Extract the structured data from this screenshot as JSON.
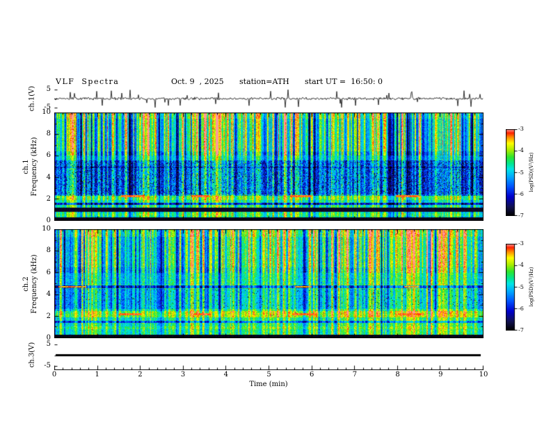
{
  "header": {
    "title": "VLF  Spectra",
    "date": "Oct. 9  , 2025",
    "station": "station=ATH",
    "start_ut": "start UT =  16:50: 0"
  },
  "xaxis": {
    "label": "Time (min)",
    "ticks": [
      "0",
      "1",
      "2",
      "3",
      "4",
      "5",
      "6",
      "7",
      "8",
      "9",
      "10"
    ],
    "range": [
      0,
      10
    ]
  },
  "panels": {
    "ch1_wave": {
      "ylabel": "ch.1(V)",
      "yticks": [
        "5",
        "-5"
      ],
      "yrange_shown": [
        5,
        -5
      ]
    },
    "ch1_spec": {
      "ylabel_line1": "ch.1",
      "ylabel_line2": "Frequency (kHz)",
      "yticks": [
        "10",
        "8",
        "6",
        "4",
        "2",
        "0"
      ]
    },
    "ch2_spec": {
      "ylabel_line1": "ch.2",
      "ylabel_line2": "Frequency (kHz)",
      "yticks": [
        "10",
        "8",
        "6",
        "4",
        "2",
        "0"
      ]
    },
    "ch3_wave": {
      "ylabel": "ch.3(V)",
      "yticks": [
        "5",
        "-5"
      ],
      "yrange_shown": [
        5,
        -5
      ]
    }
  },
  "colorbar": {
    "label": "log(PSD)(V²/Hz)",
    "ticks": [
      "-3",
      "-4",
      "-5",
      "-6",
      "-7"
    ],
    "range": [
      -7,
      -3
    ]
  },
  "colors": {
    "background": "#ffffff",
    "ink": "#000000",
    "colormap_stops": [
      [
        0.0,
        "#000000"
      ],
      [
        0.1,
        "#12124f"
      ],
      [
        0.22,
        "#0000cd"
      ],
      [
        0.34,
        "#0055ff"
      ],
      [
        0.45,
        "#00aaff"
      ],
      [
        0.54,
        "#00e6e6"
      ],
      [
        0.6,
        "#00e696"
      ],
      [
        0.68,
        "#2ee62e"
      ],
      [
        0.76,
        "#aaee00"
      ],
      [
        0.84,
        "#ffff00"
      ],
      [
        0.91,
        "#ff8c00"
      ],
      [
        0.96,
        "#ff2200"
      ],
      [
        1.0,
        "#ff9999"
      ]
    ]
  },
  "chart_data": [
    {
      "type": "line",
      "name": "ch1-voltage-waveform",
      "ylabel": "ch.1(V)",
      "ylim": [
        -7,
        7
      ],
      "yticks": [
        5,
        -5
      ],
      "xlim": [
        0,
        10
      ],
      "description": "Broadband noisy waveform centered on 0 V (~±1 V) with frequent impulsive spikes reaching ±5 V throughout the 10-minute record.",
      "gen": {
        "seed": 99,
        "noise_v": 0.55,
        "spike_prob": 0.055,
        "spike_vmin": 1.8,
        "spike_vmax": 5.0
      }
    },
    {
      "type": "heatmap",
      "name": "ch1-spectrogram",
      "xlabel": "Time (min)",
      "ylabel": "Frequency (kHz)",
      "xlim": [
        0,
        10
      ],
      "flim": [
        0,
        10
      ],
      "clim": [
        -7,
        -3
      ],
      "description": "VLF spectrogram: green/cyan sferic background with dense vertical impulsive stripes; suppressed blue speckled hiss band ~2.3-5.6 kHz; bright band near 2 kHz with intermittent dark-red narrowband bursts near 2.25 kHz; dark bands near 1 kHz and below 0.35 kHz; slightly enhanced power near 10 kHz.",
      "gen": {
        "seed": 20251009,
        "base": 0.6,
        "noise": 0.09,
        "stripe_gain": {
          "low": 0.45,
          "mid": 0.55,
          "high": 0.85
        },
        "col_bright_prob": 0.05,
        "col_dark_prob": 0.06,
        "bands": [
          {
            "f0": 2.3,
            "f1": 5.6,
            "delta": -0.21,
            "noise": 0.07,
            "dots": 0.05
          },
          {
            "f0": 5.6,
            "f1": 6.4,
            "delta": -0.08
          },
          {
            "f0": 9.4,
            "f1": 10.0,
            "delta": 0.07
          },
          {
            "f0": 1.9,
            "f1": 2.45,
            "delta": 0.1
          },
          {
            "f0": 4.85,
            "f1": 5.0,
            "delta": -0.12
          },
          {
            "f0": 1.45,
            "f1": 1.65,
            "delta": -0.35
          },
          {
            "f0": 0.85,
            "f1": 1.2,
            "set": 0.05
          },
          {
            "f0": 0.45,
            "f1": 0.7,
            "delta": 0.05
          },
          {
            "f0": 0.0,
            "f1": 0.35,
            "set": 0.03
          }
        ],
        "streaks": [
          {
            "f": 2.25,
            "halfwidth": 0.09,
            "value": 0.94,
            "segments": [
              [
                1.55,
                2.1
              ],
              [
                3.2,
                3.6
              ],
              [
                5.5,
                6.0
              ],
              [
                7.95,
                8.5
              ]
            ]
          }
        ]
      }
    },
    {
      "type": "heatmap",
      "name": "ch2-spectrogram",
      "xlabel": "Time (min)",
      "ylabel": "Frequency (kHz)",
      "xlim": [
        0,
        10
      ],
      "flim": [
        0,
        10
      ],
      "clim": [
        -7,
        -3
      ],
      "description": "VLF spectrogram: greener overall than ch.1; bright yellow-green band ~1.9-2.5 kHz with intermittent dark-red bursts near 2.2 kHz; dark narrow line near 4.7 kHz with red dashes; weak blue band 2.7-4.5 kHz; black band below 0.3 kHz; dense vertical sferic stripes across all frequencies.",
      "gen": {
        "seed": 424242,
        "base": 0.62,
        "noise": 0.1,
        "stripe_gain": {
          "low": 0.4,
          "mid": 0.5,
          "high": 0.75
        },
        "col_bright_prob": 0.06,
        "col_dark_prob": 0.05,
        "bands": [
          {
            "f0": 2.7,
            "f1": 4.5,
            "delta": -0.1,
            "dots": 0.02
          },
          {
            "f0": 5.0,
            "f1": 6.5,
            "delta": -0.05
          },
          {
            "f0": 9.3,
            "f1": 10.0,
            "delta": 0.08
          },
          {
            "f0": 1.9,
            "f1": 2.5,
            "delta": 0.14
          },
          {
            "f0": 4.6,
            "f1": 4.85,
            "delta": -0.3
          },
          {
            "f0": 1.4,
            "f1": 1.6,
            "delta": -0.25
          },
          {
            "f0": 0.8,
            "f1": 1.1,
            "delta": 0.06
          },
          {
            "f0": 0.0,
            "f1": 0.3,
            "set": 0.03
          }
        ],
        "streaks": [
          {
            "f": 2.22,
            "halfwidth": 0.09,
            "value": 0.94,
            "segments": [
              [
                1.5,
                2.05
              ],
              [
                3.25,
                3.65
              ],
              [
                5.55,
                6.1
              ],
              [
                8.0,
                8.6
              ]
            ]
          },
          {
            "f": 4.72,
            "halfwidth": 0.07,
            "value": 0.9,
            "segments": [
              [
                0.1,
                0.75
              ],
              [
                5.6,
                6.0
              ],
              [
                8.15,
                8.5
              ]
            ]
          }
        ]
      }
    },
    {
      "type": "line",
      "name": "ch3-voltage-waveform",
      "ylabel": "ch.3(V)",
      "ylim": [
        -7,
        7
      ],
      "yticks": [
        5,
        -5
      ],
      "xlim": [
        0,
        10
      ],
      "constant_value": 0,
      "description": "Flat thick black line at 0 V across the whole record (channel inactive)."
    }
  ]
}
